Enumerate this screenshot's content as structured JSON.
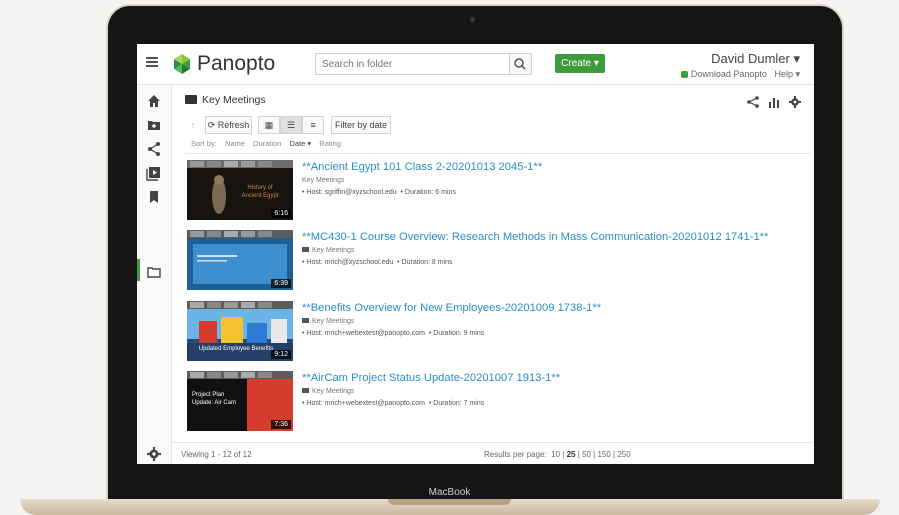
{
  "device": {
    "label": "MacBook"
  },
  "header": {
    "logo_text": "Panopto",
    "search_placeholder": "Search in folder",
    "create_label": "Create",
    "user_name": "David Dumler",
    "download_label": "Download Panopto",
    "help_label": "Help"
  },
  "sidebar": {
    "items": [
      "home-icon",
      "folder-plus-icon",
      "share-icon",
      "video-library-icon",
      "bookmark-icon",
      "folder-icon"
    ],
    "settings_icon": "gear-icon"
  },
  "folder": {
    "name": "Key Meetings",
    "refresh_label": "Refresh",
    "filter_label": "Filter by date",
    "sort_prefix": "Sort by:",
    "sort_options": [
      "Name",
      "Duration",
      "Date ▾",
      "Rating"
    ]
  },
  "sessions": [
    {
      "title": "**Ancient Egypt 101 Class 2-20201013 2045-1**",
      "folder": "Key Meetings",
      "host": "• Host: sgriffin@xyzschool.edu",
      "duration": "• Duration: 6 mins",
      "thumb_duration": "6:16",
      "thumb_caption": "History of Ancient Egypt"
    },
    {
      "title": "**MC430-1 Course Overview: Research Methods in Mass Communication-20201012 1741-1**",
      "folder": "Key Meetings",
      "host": "• Host: mrich@xyzschool.edu",
      "duration": "• Duration: 8 mins",
      "thumb_duration": "6:39",
      "thumb_caption": ""
    },
    {
      "title": "**Benefits Overview for New Employees-20201009 1738-1**",
      "folder": "Key Meetings",
      "host": "• Host: mrich+webextest@panopto.com",
      "duration": "• Duration: 9 mins",
      "thumb_duration": "9:12",
      "thumb_caption": "Updated Employee Benefits"
    },
    {
      "title": "**AirCam Project Status Update-20201007 1913-1**",
      "folder": "Key Meetings",
      "host": "• Host: mrich+webextest@panopto.com",
      "duration": "• Duration: 7 mins",
      "thumb_duration": "7:36",
      "thumb_caption": "Project Plan Update: Air Cam"
    }
  ],
  "footer": {
    "viewing": "Viewing 1 - 12 of 12",
    "results_per_page_label": "Results per page:",
    "options": [
      "10",
      "25",
      "50",
      "150",
      "250"
    ],
    "selected": "25"
  },
  "colors": {
    "brand_green": "#3e9a3d",
    "link_blue": "#2a8fc7"
  }
}
